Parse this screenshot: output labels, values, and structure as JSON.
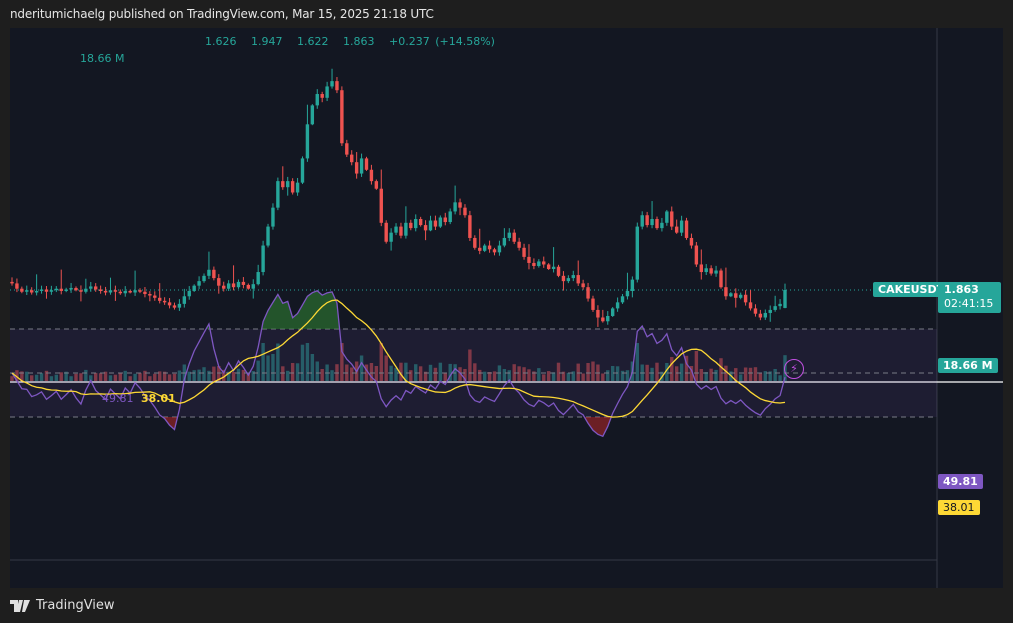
{
  "header": {
    "published": "nderitumichaelg published on TradingView.com, Mar 15, 2025 21:18 UTC"
  },
  "legend": {
    "open": "1.626",
    "high": "1.947",
    "low": "1.622",
    "close": "1.863",
    "change": "+0.237 (+14.58%)",
    "volume": "18.66 M"
  },
  "price_axis": {
    "symbol": "CAKEUSDT",
    "last_price": "1.863",
    "countdown": "02:41:15",
    "volume_label": "18.66 M",
    "rsi_label": "49.81",
    "rsi_ma_label": "38.01"
  },
  "rsi_legend": {
    "rsi": "49.81",
    "ma": "38.01"
  },
  "footer": {
    "brand": "TradingView"
  },
  "colors": {
    "up": "#26a69a",
    "down": "#ef5350",
    "rsi": "#7e57c2",
    "rsi_ma": "#fdd835",
    "bg": "#131722"
  },
  "chart_data": {
    "type": "candlestick",
    "symbol": "CAKEUSDT",
    "closes": [
      1.95,
      1.88,
      1.84,
      1.86,
      1.83,
      1.85,
      1.87,
      1.84,
      1.86,
      1.88,
      1.85,
      1.87,
      1.89,
      1.86,
      1.84,
      1.88,
      1.91,
      1.87,
      1.85,
      1.83,
      1.86,
      1.84,
      1.82,
      1.85,
      1.83,
      1.86,
      1.84,
      1.81,
      1.79,
      1.76,
      1.72,
      1.7,
      1.66,
      1.63,
      1.68,
      1.78,
      1.85,
      1.92,
      1.98,
      2.05,
      2.13,
      2.02,
      1.92,
      1.88,
      1.95,
      1.9,
      1.97,
      1.93,
      1.88,
      1.94,
      2.1,
      2.45,
      2.7,
      2.95,
      3.3,
      3.22,
      3.3,
      3.15,
      3.28,
      3.6,
      4.05,
      4.3,
      4.45,
      4.4,
      4.55,
      4.62,
      4.5,
      3.8,
      3.65,
      3.55,
      3.4,
      3.6,
      3.45,
      3.3,
      3.2,
      2.75,
      2.5,
      2.62,
      2.7,
      2.58,
      2.75,
      2.68,
      2.8,
      2.72,
      2.65,
      2.78,
      2.7,
      2.82,
      2.76,
      2.9,
      3.02,
      2.95,
      2.85,
      2.55,
      2.42,
      2.38,
      2.45,
      2.4,
      2.36,
      2.45,
      2.55,
      2.62,
      2.5,
      2.42,
      2.3,
      2.22,
      2.18,
      2.24,
      2.2,
      2.14,
      2.17,
      2.05,
      1.98,
      2.02,
      2.06,
      1.95,
      1.9,
      1.75,
      1.6,
      1.5,
      1.45,
      1.52,
      1.62,
      1.7,
      1.78,
      1.85,
      2.0,
      2.7,
      2.85,
      2.72,
      2.8,
      2.68,
      2.75,
      2.9,
      2.7,
      2.62,
      2.78,
      2.55,
      2.45,
      2.2,
      2.1,
      2.15,
      2.08,
      2.12,
      1.9,
      1.78,
      1.82,
      1.76,
      1.8,
      1.7,
      1.62,
      1.55,
      1.5,
      1.56,
      1.6,
      1.65,
      1.68,
      1.863
    ],
    "last_candle": {
      "open": 1.626,
      "high": 1.947,
      "low": 1.622,
      "close": 1.863
    },
    "rsi_levels": [
      70,
      50,
      30
    ],
    "rsi_period": 14,
    "rsi_ma_period": 14
  }
}
